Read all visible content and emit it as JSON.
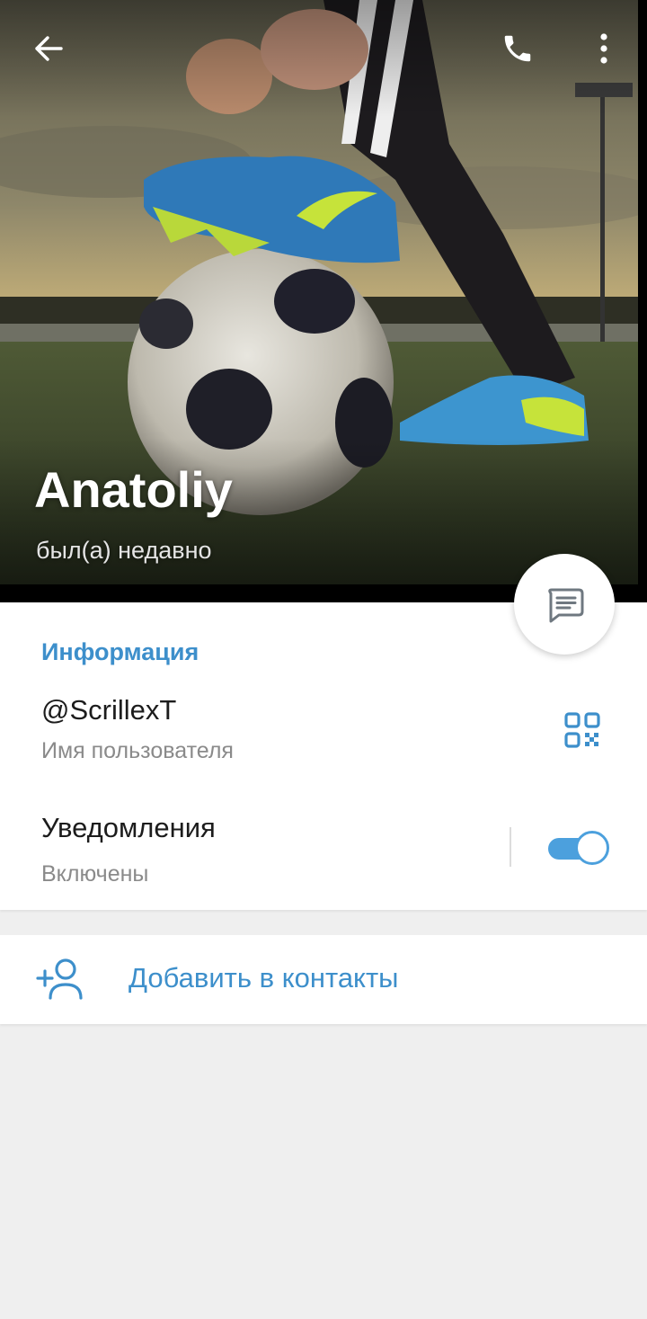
{
  "profile": {
    "name": "Anatoliy",
    "status": "был(а) недавно"
  },
  "info": {
    "section_title": "Информация",
    "username": "@ScrillexT",
    "username_caption": "Имя пользователя",
    "notifications_label": "Уведомления",
    "notifications_value": "Включены",
    "notifications_enabled": true
  },
  "actions": {
    "add_contact_label": "Добавить в контакты"
  },
  "icons": {
    "back": "arrow-left-icon",
    "call": "phone-icon",
    "more": "more-vertical-icon",
    "message": "chat-icon",
    "qr": "qr-code-icon",
    "add_contact": "add-user-icon"
  },
  "colors": {
    "accent": "#3d8fcb",
    "toggle_on": "#4ca0dd",
    "background": "#efefef",
    "secondary_text": "#8a8a8a"
  }
}
